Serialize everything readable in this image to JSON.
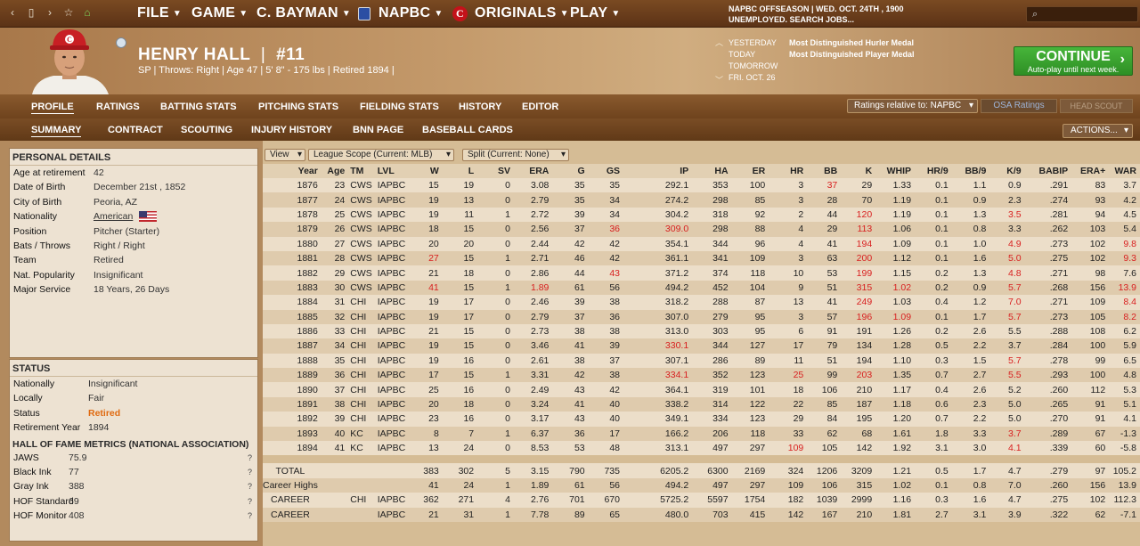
{
  "topbar": {
    "menus": [
      {
        "label": "FILE"
      },
      {
        "label": "GAME"
      },
      {
        "label": "C. BAYMAN"
      },
      {
        "label": "NAPBC"
      },
      {
        "label": "ORIGINALS"
      },
      {
        "label": "PLAY"
      }
    ],
    "status_line1": "NAPBC OFFSEASON  |  WED. OCT. 24TH , 1900",
    "status_line2": "UNEMPLOYED. SEARCH JOBS...",
    "search_icon": "search-icon"
  },
  "player": {
    "name": "HENRY HALL",
    "number": "#11",
    "subline": "SP | Throws: Right  |  Age 47  |  5' 8\" - 175 lbs  |  Retired 1894  |",
    "cap_letter": "C"
  },
  "calendar": {
    "rows": [
      {
        "label": "YESTERDAY",
        "event": "Most Distinguished Hurler Medal"
      },
      {
        "label": "TODAY",
        "event": "Most Distinguished Player Medal"
      },
      {
        "label": "TOMORROW",
        "event": ""
      },
      {
        "label": "FRI. OCT. 26",
        "event": ""
      }
    ]
  },
  "continue": {
    "label": "CONTINUE",
    "sub": "Auto-play until next week."
  },
  "tabs_main": [
    "PROFILE",
    "RATINGS",
    "BATTING STATS",
    "PITCHING STATS",
    "FIELDING STATS",
    "HISTORY",
    "EDITOR"
  ],
  "tabs_sub": [
    "SUMMARY",
    "CONTRACT",
    "SCOUTING",
    "INJURY HISTORY",
    "BNN PAGE",
    "BASEBALL CARDS"
  ],
  "ratings_dropdown": "Ratings relative to: NAPBC",
  "osa_button": "OSA Ratings",
  "head_scout_button": "HEAD SCOUT",
  "actions_button": "ACTIONS...",
  "personal": {
    "title": "PERSONAL DETAILS",
    "rows": [
      {
        "k": "Age at retirement",
        "v": "42"
      },
      {
        "k": "Date of Birth",
        "v": "December 21st , 1852"
      },
      {
        "k": "City of Birth",
        "v": "Peoria, AZ"
      },
      {
        "k": "Nationality",
        "v": "American"
      },
      {
        "k": "Position",
        "v": "Pitcher (Starter)"
      },
      {
        "k": "Bats / Throws",
        "v": "Right / Right"
      },
      {
        "k": "Team",
        "v": "Retired"
      },
      {
        "k": "Nat. Popularity",
        "v": "Insignificant"
      },
      {
        "k": "Major Service",
        "v": "18 Years, 26 Days"
      }
    ]
  },
  "status": {
    "title": "STATUS",
    "rows": [
      {
        "k": "Nationally",
        "v": "Insignificant"
      },
      {
        "k": "Locally",
        "v": "Fair"
      },
      {
        "k": "Status",
        "v": "Retired"
      },
      {
        "k": "Retirement Year",
        "v": "1894"
      }
    ],
    "hof_title": "HALL OF FAME METRICS (NATIONAL ASSOCIATION)",
    "hof": [
      {
        "k": "JAWS",
        "v": "75.9"
      },
      {
        "k": "Black Ink",
        "v": "77"
      },
      {
        "k": "Gray Ink",
        "v": "388"
      },
      {
        "k": "HOF Standard",
        "v": "69"
      },
      {
        "k": "HOF Monitor",
        "v": "408"
      }
    ]
  },
  "filters": {
    "view": "View",
    "scope": "League Scope (Current: MLB)",
    "split": "Split (Current: None)"
  },
  "columns": [
    "Year",
    "Age",
    "TM",
    "LVL",
    "W",
    "L",
    "SV",
    "ERA",
    "G",
    "GS",
    "IP",
    "HA",
    "ER",
    "HR",
    "BB",
    "K",
    "WHIP",
    "HR/9",
    "BB/9",
    "K/9",
    "BABIP",
    "ERA+",
    "WAR"
  ],
  "rows": [
    {
      "c": [
        "1876",
        "23",
        "CWS",
        "IAPBC",
        "15",
        "19",
        "0",
        "3.08",
        "35",
        "35",
        "292.1",
        "353",
        "100",
        "3",
        "37",
        "29",
        "1.33",
        "0.1",
        "1.1",
        "0.9",
        ".291",
        "83",
        "3.7"
      ],
      "red": [
        14
      ]
    },
    {
      "c": [
        "1877",
        "24",
        "CWS",
        "IAPBC",
        "19",
        "13",
        "0",
        "2.79",
        "35",
        "34",
        "274.2",
        "298",
        "85",
        "3",
        "28",
        "70",
        "1.19",
        "0.1",
        "0.9",
        "2.3",
        ".274",
        "93",
        "4.2"
      ],
      "red": []
    },
    {
      "c": [
        "1878",
        "25",
        "CWS",
        "IAPBC",
        "19",
        "11",
        "1",
        "2.72",
        "39",
        "34",
        "304.2",
        "318",
        "92",
        "2",
        "44",
        "120",
        "1.19",
        "0.1",
        "1.3",
        "3.5",
        ".281",
        "94",
        "4.5"
      ],
      "red": [
        15,
        19
      ]
    },
    {
      "c": [
        "1879",
        "26",
        "CWS",
        "IAPBC",
        "18",
        "15",
        "0",
        "2.56",
        "37",
        "36",
        "309.0",
        "298",
        "88",
        "4",
        "29",
        "113",
        "1.06",
        "0.1",
        "0.8",
        "3.3",
        ".262",
        "103",
        "5.4"
      ],
      "red": [
        9,
        10,
        15
      ]
    },
    {
      "c": [
        "1880",
        "27",
        "CWS",
        "IAPBC",
        "20",
        "20",
        "0",
        "2.44",
        "42",
        "42",
        "354.1",
        "344",
        "96",
        "4",
        "41",
        "194",
        "1.09",
        "0.1",
        "1.0",
        "4.9",
        ".273",
        "102",
        "9.8"
      ],
      "red": [
        15,
        19,
        22
      ]
    },
    {
      "c": [
        "1881",
        "28",
        "CWS",
        "IAPBC",
        "27",
        "15",
        "1",
        "2.71",
        "46",
        "42",
        "361.1",
        "341",
        "109",
        "3",
        "63",
        "200",
        "1.12",
        "0.1",
        "1.6",
        "5.0",
        ".275",
        "102",
        "9.3"
      ],
      "red": [
        4,
        15,
        19,
        22
      ]
    },
    {
      "c": [
        "1882",
        "29",
        "CWS",
        "IAPBC",
        "21",
        "18",
        "0",
        "2.86",
        "44",
        "43",
        "371.2",
        "374",
        "118",
        "10",
        "53",
        "199",
        "1.15",
        "0.2",
        "1.3",
        "4.8",
        ".271",
        "98",
        "7.6"
      ],
      "red": [
        9,
        15,
        19
      ]
    },
    {
      "c": [
        "1883",
        "30",
        "CWS",
        "IAPBC",
        "41",
        "15",
        "1",
        "1.89",
        "61",
        "56",
        "494.2",
        "452",
        "104",
        "9",
        "51",
        "315",
        "1.02",
        "0.2",
        "0.9",
        "5.7",
        ".268",
        "156",
        "13.9"
      ],
      "red": [
        4,
        7,
        15,
        16,
        19,
        22
      ]
    },
    {
      "c": [
        "1884",
        "31",
        "CHI",
        "IAPBC",
        "19",
        "17",
        "0",
        "2.46",
        "39",
        "38",
        "318.2",
        "288",
        "87",
        "13",
        "41",
        "249",
        "1.03",
        "0.4",
        "1.2",
        "7.0",
        ".271",
        "109",
        "8.4"
      ],
      "red": [
        15,
        19,
        22
      ]
    },
    {
      "c": [
        "1885",
        "32",
        "CHI",
        "IAPBC",
        "19",
        "17",
        "0",
        "2.79",
        "37",
        "36",
        "307.0",
        "279",
        "95",
        "3",
        "57",
        "196",
        "1.09",
        "0.1",
        "1.7",
        "5.7",
        ".273",
        "105",
        "8.2"
      ],
      "red": [
        15,
        16,
        19,
        22
      ]
    },
    {
      "c": [
        "1886",
        "33",
        "CHI",
        "IAPBC",
        "21",
        "15",
        "0",
        "2.73",
        "38",
        "38",
        "313.0",
        "303",
        "95",
        "6",
        "91",
        "191",
        "1.26",
        "0.2",
        "2.6",
        "5.5",
        ".288",
        "108",
        "6.2"
      ],
      "red": []
    },
    {
      "c": [
        "1887",
        "34",
        "CHI",
        "IAPBC",
        "19",
        "15",
        "0",
        "3.46",
        "41",
        "39",
        "330.1",
        "344",
        "127",
        "17",
        "79",
        "134",
        "1.28",
        "0.5",
        "2.2",
        "3.7",
        ".284",
        "100",
        "5.9"
      ],
      "red": [
        10
      ]
    },
    {
      "c": [
        "1888",
        "35",
        "CHI",
        "IAPBC",
        "19",
        "16",
        "0",
        "2.61",
        "38",
        "37",
        "307.1",
        "286",
        "89",
        "11",
        "51",
        "194",
        "1.10",
        "0.3",
        "1.5",
        "5.7",
        ".278",
        "99",
        "6.5"
      ],
      "red": [
        19
      ]
    },
    {
      "c": [
        "1889",
        "36",
        "CHI",
        "IAPBC",
        "17",
        "15",
        "1",
        "3.31",
        "42",
        "38",
        "334.1",
        "352",
        "123",
        "25",
        "99",
        "203",
        "1.35",
        "0.7",
        "2.7",
        "5.5",
        ".293",
        "100",
        "4.8"
      ],
      "red": [
        10,
        13,
        15,
        19
      ]
    },
    {
      "c": [
        "1890",
        "37",
        "CHI",
        "IAPBC",
        "25",
        "16",
        "0",
        "2.49",
        "43",
        "42",
        "364.1",
        "319",
        "101",
        "18",
        "106",
        "210",
        "1.17",
        "0.4",
        "2.6",
        "5.2",
        ".260",
        "112",
        "5.3"
      ],
      "red": []
    },
    {
      "c": [
        "1891",
        "38",
        "CHI",
        "IAPBC",
        "20",
        "18",
        "0",
        "3.24",
        "41",
        "40",
        "338.2",
        "314",
        "122",
        "22",
        "85",
        "187",
        "1.18",
        "0.6",
        "2.3",
        "5.0",
        ".265",
        "91",
        "5.1"
      ],
      "red": []
    },
    {
      "c": [
        "1892",
        "39",
        "CHI",
        "IAPBC",
        "23",
        "16",
        "0",
        "3.17",
        "43",
        "40",
        "349.1",
        "334",
        "123",
        "29",
        "84",
        "195",
        "1.20",
        "0.7",
        "2.2",
        "5.0",
        ".270",
        "91",
        "4.1"
      ],
      "red": []
    },
    {
      "c": [
        "1893",
        "40",
        "KC",
        "IAPBC",
        "8",
        "7",
        "1",
        "6.37",
        "36",
        "17",
        "166.2",
        "206",
        "118",
        "33",
        "62",
        "68",
        "1.61",
        "1.8",
        "3.3",
        "3.7",
        ".289",
        "67",
        "-1.3"
      ],
      "red": [
        19
      ]
    },
    {
      "c": [
        "1894",
        "41",
        "KC",
        "IAPBC",
        "13",
        "24",
        "0",
        "8.53",
        "53",
        "48",
        "313.1",
        "497",
        "297",
        "109",
        "105",
        "142",
        "1.92",
        "3.1",
        "3.0",
        "4.1",
        ".339",
        "60",
        "-5.8"
      ],
      "red": [
        13,
        19
      ]
    }
  ],
  "totals": [
    {
      "c": [
        "TOTAL",
        "",
        "",
        "",
        "383",
        "302",
        "5",
        "3.15",
        "790",
        "735",
        "6205.2",
        "6300",
        "2169",
        "324",
        "1206",
        "3209",
        "1.21",
        "0.5",
        "1.7",
        "4.7",
        ".279",
        "97",
        "105.2"
      ]
    },
    {
      "c": [
        "Career Highs",
        "",
        "",
        "",
        "41",
        "24",
        "1",
        "1.89",
        "61",
        "56",
        "494.2",
        "497",
        "297",
        "109",
        "106",
        "315",
        "1.02",
        "0.1",
        "0.8",
        "7.0",
        ".260",
        "156",
        "13.9"
      ]
    },
    {
      "c": [
        "CAREER",
        "",
        "CHI",
        "IAPBC",
        "362",
        "271",
        "4",
        "2.76",
        "701",
        "670",
        "5725.2",
        "5597",
        "1754",
        "182",
        "1039",
        "2999",
        "1.16",
        "0.3",
        "1.6",
        "4.7",
        ".275",
        "102",
        "112.3"
      ]
    },
    {
      "c": [
        "CAREER",
        "",
        "",
        "IAPBC",
        "21",
        "31",
        "1",
        "7.78",
        "89",
        "65",
        "480.0",
        "703",
        "415",
        "142",
        "167",
        "210",
        "1.81",
        "2.7",
        "3.1",
        "3.9",
        ".322",
        "62",
        "-7.1"
      ]
    }
  ]
}
